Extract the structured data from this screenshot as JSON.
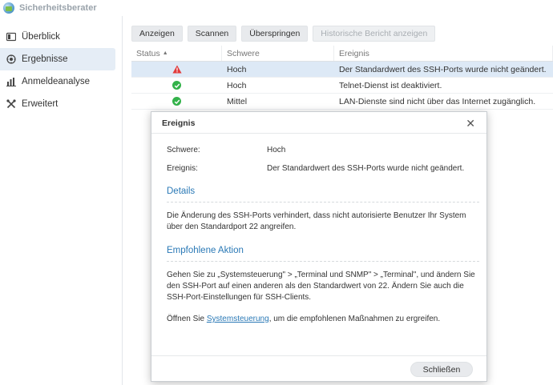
{
  "app": {
    "title": "Sicherheitsberater"
  },
  "sidebar": {
    "items": [
      {
        "label": "Überblick",
        "icon": "overview-icon"
      },
      {
        "label": "Ergebnisse",
        "icon": "results-icon"
      },
      {
        "label": "Anmeldeanalyse",
        "icon": "chart-icon"
      },
      {
        "label": "Erweitert",
        "icon": "tools-icon"
      }
    ]
  },
  "toolbar": {
    "show_label": "Anzeigen",
    "scan_label": "Scannen",
    "skip_label": "Überspringen",
    "history_label": "Historische Bericht anzeigen"
  },
  "grid": {
    "headers": {
      "status": "Status",
      "severity": "Schwere",
      "event": "Ereignis"
    },
    "rows": [
      {
        "status": "warning",
        "severity": "Hoch",
        "event": "Der Standardwert des SSH-Ports wurde nicht geändert."
      },
      {
        "status": "ok",
        "severity": "Hoch",
        "event": "Telnet-Dienst ist deaktiviert."
      },
      {
        "status": "ok",
        "severity": "Mittel",
        "event": "LAN-Dienste sind nicht über das Internet zugänglich."
      }
    ]
  },
  "dialog": {
    "title": "Ereignis",
    "severity_label": "Schwere:",
    "severity_value": "Hoch",
    "event_label": "Ereignis:",
    "event_value": "Der Standardwert des SSH-Ports wurde nicht geändert.",
    "details_heading": "Details",
    "details_text": "Die Änderung des SSH-Ports verhindert, dass nicht autorisierte Benutzer Ihr System über den Standardport 22 angreifen.",
    "action_heading": "Empfohlene Aktion",
    "action_text": "Gehen Sie zu „Systemsteuerung\" > „Terminal und SNMP\" > „Terminal\", und ändern Sie den SSH-Port auf einen anderen als den Standardwert von 22. Ändern Sie auch die SSH-Port-Einstellungen für SSH-Clients.",
    "action_open_prefix": "Öffnen Sie ",
    "action_open_link": "Systemsteuerung",
    "action_open_suffix": ", um die empfohlenen Maßnahmen zu ergreifen.",
    "close_label": "Schließen"
  },
  "colors": {
    "accent": "#2a79b6",
    "ok": "#33b24a",
    "warning": "#e23b3b",
    "selected_row": "#dde9f6"
  }
}
